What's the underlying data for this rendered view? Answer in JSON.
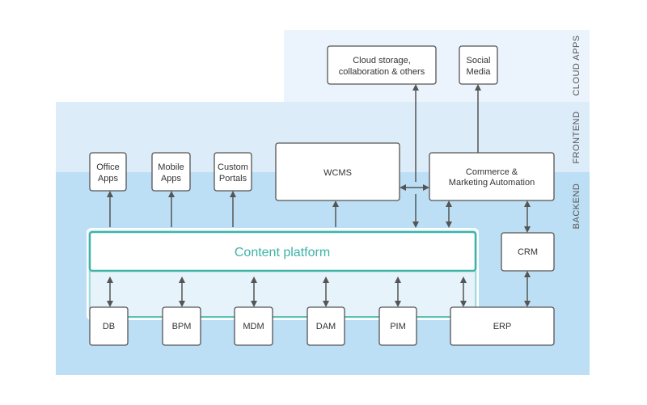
{
  "lanes": {
    "cloud": "CLOUD APPS",
    "frontend": "FRONTEND",
    "backend": "BACKEND"
  },
  "nodes": {
    "office": [
      "Office",
      "Apps"
    ],
    "mobile": [
      "Mobile",
      "Apps"
    ],
    "custom": [
      "Custom",
      "Portals"
    ],
    "wcms": "WCMS",
    "commerce": [
      "Commerce &",
      "Marketing Automation"
    ],
    "cloud_storage": [
      "Cloud storage,",
      "collaboration & others"
    ],
    "social": [
      "Social",
      "Media"
    ],
    "crm": "CRM",
    "platform": "Content platform",
    "db": "DB",
    "bpm": "BPM",
    "mdm": "MDM",
    "dam": "DAM",
    "pim": "PIM",
    "erp": "ERP"
  },
  "colors": {
    "cloud": "#ebf4fc",
    "frontend": "#dcecf9",
    "backend": "#bcdff5",
    "platform": "#3db3a8"
  }
}
